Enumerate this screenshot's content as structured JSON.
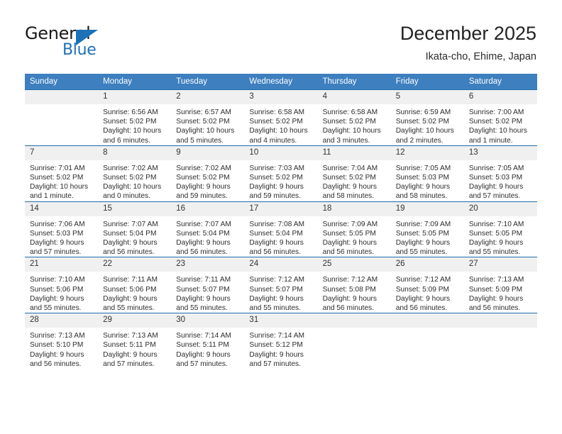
{
  "brand": {
    "name_top": "General",
    "name_bottom": "Blue",
    "accent_color": "#1d71b8"
  },
  "header": {
    "title": "December 2025",
    "subtitle": "Ikata-cho, Ehime, Japan"
  },
  "theme": {
    "header_bg": "#3d7fbf",
    "row_separator": "#1f6cb0",
    "daynum_bg": "#f0f0f0"
  },
  "labels": {
    "sunrise_prefix": "Sunrise:",
    "sunset_prefix": "Sunset:",
    "daylight_prefix": "Daylight:"
  },
  "weekdays": [
    "Sunday",
    "Monday",
    "Tuesday",
    "Wednesday",
    "Thursday",
    "Friday",
    "Saturday"
  ],
  "weeks": [
    [
      {
        "day": "",
        "sunrise": "",
        "sunset": "",
        "daylight_1": "",
        "daylight_2": ""
      },
      {
        "day": "1",
        "sunrise": "Sunrise: 6:56 AM",
        "sunset": "Sunset: 5:02 PM",
        "daylight_1": "Daylight: 10 hours",
        "daylight_2": "and 6 minutes."
      },
      {
        "day": "2",
        "sunrise": "Sunrise: 6:57 AM",
        "sunset": "Sunset: 5:02 PM",
        "daylight_1": "Daylight: 10 hours",
        "daylight_2": "and 5 minutes."
      },
      {
        "day": "3",
        "sunrise": "Sunrise: 6:58 AM",
        "sunset": "Sunset: 5:02 PM",
        "daylight_1": "Daylight: 10 hours",
        "daylight_2": "and 4 minutes."
      },
      {
        "day": "4",
        "sunrise": "Sunrise: 6:58 AM",
        "sunset": "Sunset: 5:02 PM",
        "daylight_1": "Daylight: 10 hours",
        "daylight_2": "and 3 minutes."
      },
      {
        "day": "5",
        "sunrise": "Sunrise: 6:59 AM",
        "sunset": "Sunset: 5:02 PM",
        "daylight_1": "Daylight: 10 hours",
        "daylight_2": "and 2 minutes."
      },
      {
        "day": "6",
        "sunrise": "Sunrise: 7:00 AM",
        "sunset": "Sunset: 5:02 PM",
        "daylight_1": "Daylight: 10 hours",
        "daylight_2": "and 1 minute."
      }
    ],
    [
      {
        "day": "7",
        "sunrise": "Sunrise: 7:01 AM",
        "sunset": "Sunset: 5:02 PM",
        "daylight_1": "Daylight: 10 hours",
        "daylight_2": "and 1 minute."
      },
      {
        "day": "8",
        "sunrise": "Sunrise: 7:02 AM",
        "sunset": "Sunset: 5:02 PM",
        "daylight_1": "Daylight: 10 hours",
        "daylight_2": "and 0 minutes."
      },
      {
        "day": "9",
        "sunrise": "Sunrise: 7:02 AM",
        "sunset": "Sunset: 5:02 PM",
        "daylight_1": "Daylight: 9 hours",
        "daylight_2": "and 59 minutes."
      },
      {
        "day": "10",
        "sunrise": "Sunrise: 7:03 AM",
        "sunset": "Sunset: 5:02 PM",
        "daylight_1": "Daylight: 9 hours",
        "daylight_2": "and 59 minutes."
      },
      {
        "day": "11",
        "sunrise": "Sunrise: 7:04 AM",
        "sunset": "Sunset: 5:02 PM",
        "daylight_1": "Daylight: 9 hours",
        "daylight_2": "and 58 minutes."
      },
      {
        "day": "12",
        "sunrise": "Sunrise: 7:05 AM",
        "sunset": "Sunset: 5:03 PM",
        "daylight_1": "Daylight: 9 hours",
        "daylight_2": "and 58 minutes."
      },
      {
        "day": "13",
        "sunrise": "Sunrise: 7:05 AM",
        "sunset": "Sunset: 5:03 PM",
        "daylight_1": "Daylight: 9 hours",
        "daylight_2": "and 57 minutes."
      }
    ],
    [
      {
        "day": "14",
        "sunrise": "Sunrise: 7:06 AM",
        "sunset": "Sunset: 5:03 PM",
        "daylight_1": "Daylight: 9 hours",
        "daylight_2": "and 57 minutes."
      },
      {
        "day": "15",
        "sunrise": "Sunrise: 7:07 AM",
        "sunset": "Sunset: 5:04 PM",
        "daylight_1": "Daylight: 9 hours",
        "daylight_2": "and 56 minutes."
      },
      {
        "day": "16",
        "sunrise": "Sunrise: 7:07 AM",
        "sunset": "Sunset: 5:04 PM",
        "daylight_1": "Daylight: 9 hours",
        "daylight_2": "and 56 minutes."
      },
      {
        "day": "17",
        "sunrise": "Sunrise: 7:08 AM",
        "sunset": "Sunset: 5:04 PM",
        "daylight_1": "Daylight: 9 hours",
        "daylight_2": "and 56 minutes."
      },
      {
        "day": "18",
        "sunrise": "Sunrise: 7:09 AM",
        "sunset": "Sunset: 5:05 PM",
        "daylight_1": "Daylight: 9 hours",
        "daylight_2": "and 56 minutes."
      },
      {
        "day": "19",
        "sunrise": "Sunrise: 7:09 AM",
        "sunset": "Sunset: 5:05 PM",
        "daylight_1": "Daylight: 9 hours",
        "daylight_2": "and 55 minutes."
      },
      {
        "day": "20",
        "sunrise": "Sunrise: 7:10 AM",
        "sunset": "Sunset: 5:05 PM",
        "daylight_1": "Daylight: 9 hours",
        "daylight_2": "and 55 minutes."
      }
    ],
    [
      {
        "day": "21",
        "sunrise": "Sunrise: 7:10 AM",
        "sunset": "Sunset: 5:06 PM",
        "daylight_1": "Daylight: 9 hours",
        "daylight_2": "and 55 minutes."
      },
      {
        "day": "22",
        "sunrise": "Sunrise: 7:11 AM",
        "sunset": "Sunset: 5:06 PM",
        "daylight_1": "Daylight: 9 hours",
        "daylight_2": "and 55 minutes."
      },
      {
        "day": "23",
        "sunrise": "Sunrise: 7:11 AM",
        "sunset": "Sunset: 5:07 PM",
        "daylight_1": "Daylight: 9 hours",
        "daylight_2": "and 55 minutes."
      },
      {
        "day": "24",
        "sunrise": "Sunrise: 7:12 AM",
        "sunset": "Sunset: 5:07 PM",
        "daylight_1": "Daylight: 9 hours",
        "daylight_2": "and 55 minutes."
      },
      {
        "day": "25",
        "sunrise": "Sunrise: 7:12 AM",
        "sunset": "Sunset: 5:08 PM",
        "daylight_1": "Daylight: 9 hours",
        "daylight_2": "and 56 minutes."
      },
      {
        "day": "26",
        "sunrise": "Sunrise: 7:12 AM",
        "sunset": "Sunset: 5:09 PM",
        "daylight_1": "Daylight: 9 hours",
        "daylight_2": "and 56 minutes."
      },
      {
        "day": "27",
        "sunrise": "Sunrise: 7:13 AM",
        "sunset": "Sunset: 5:09 PM",
        "daylight_1": "Daylight: 9 hours",
        "daylight_2": "and 56 minutes."
      }
    ],
    [
      {
        "day": "28",
        "sunrise": "Sunrise: 7:13 AM",
        "sunset": "Sunset: 5:10 PM",
        "daylight_1": "Daylight: 9 hours",
        "daylight_2": "and 56 minutes."
      },
      {
        "day": "29",
        "sunrise": "Sunrise: 7:13 AM",
        "sunset": "Sunset: 5:11 PM",
        "daylight_1": "Daylight: 9 hours",
        "daylight_2": "and 57 minutes."
      },
      {
        "day": "30",
        "sunrise": "Sunrise: 7:14 AM",
        "sunset": "Sunset: 5:11 PM",
        "daylight_1": "Daylight: 9 hours",
        "daylight_2": "and 57 minutes."
      },
      {
        "day": "31",
        "sunrise": "Sunrise: 7:14 AM",
        "sunset": "Sunset: 5:12 PM",
        "daylight_1": "Daylight: 9 hours",
        "daylight_2": "and 57 minutes."
      },
      {
        "day": "",
        "sunrise": "",
        "sunset": "",
        "daylight_1": "",
        "daylight_2": ""
      },
      {
        "day": "",
        "sunrise": "",
        "sunset": "",
        "daylight_1": "",
        "daylight_2": ""
      },
      {
        "day": "",
        "sunrise": "",
        "sunset": "",
        "daylight_1": "",
        "daylight_2": ""
      }
    ]
  ]
}
